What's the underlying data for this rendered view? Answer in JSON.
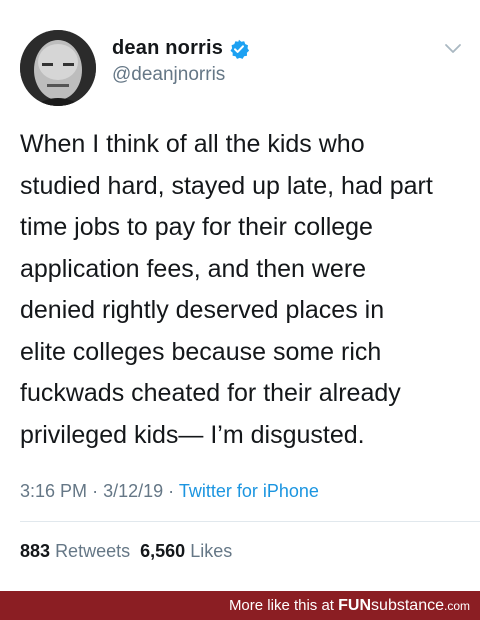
{
  "tweet": {
    "display_name": "dean norris",
    "handle": "@deanjnorris",
    "text": "When I think of all the kids who\nstudied hard, stayed up late, had part\ntime jobs to pay for their college\napplication fees, and then were\ndenied rightly deserved places in\nelite colleges because some rich\nfuckwads cheated for their already\nprivileged kids— I’m disgusted.",
    "time": "3:16 PM",
    "date": "3/12/19",
    "separator": "·",
    "source": "Twitter for iPhone",
    "retweets_count": "883",
    "retweets_label": "Retweets",
    "likes_count": "6,560",
    "likes_label": "Likes",
    "icons": {
      "verified": "verified-badge-icon",
      "chevron": "chevron-down-icon"
    },
    "colors": {
      "verified": "#1da1f2",
      "link": "#1b95e0",
      "muted": "#657786"
    }
  },
  "footer": {
    "prefix": "More like this at",
    "brand_bold": "FUN",
    "brand_rest": "substance",
    "brand_tld": ".com",
    "background": "#8b1e23"
  }
}
